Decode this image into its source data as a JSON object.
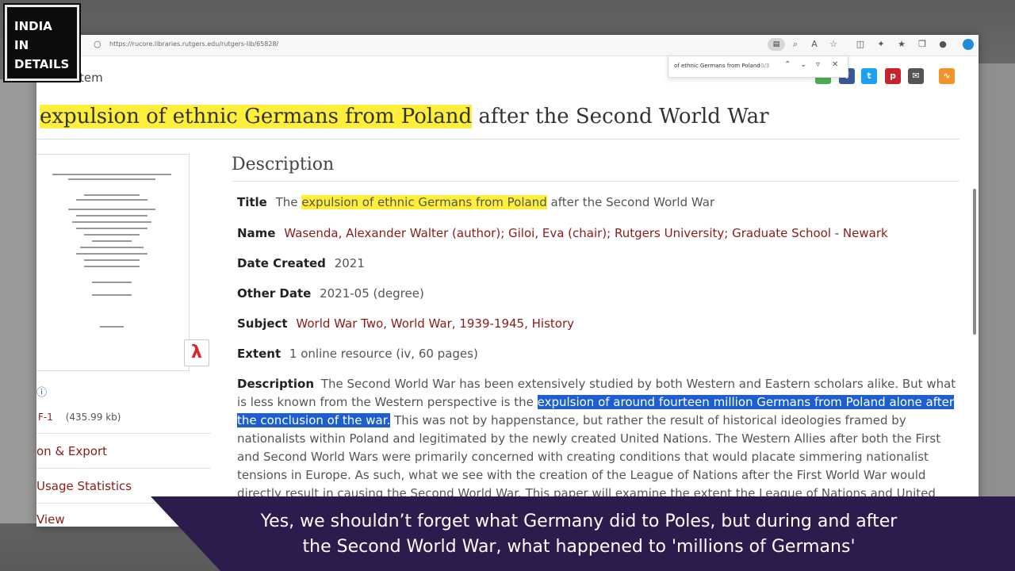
{
  "logo": {
    "line1": "INDIA",
    "line2": "IN",
    "line3": "DETAILS"
  },
  "browser": {
    "url": "https://rucore.libraries.rutgers.edu/rutgers-lib/65828/",
    "find": {
      "query": "of ethnic Germans from Poland",
      "count": "0/3"
    }
  },
  "breadcrumb": "tem",
  "page": {
    "title_hl": "expulsion of ethnic Germans from Poland",
    "title_rest": "after the Second World War"
  },
  "sidebar": {
    "file_label": "F-1",
    "file_size": "(435.99 kb)",
    "links": [
      "on & Export",
      "Usage Statistics",
      "View"
    ]
  },
  "description": {
    "heading": "Description",
    "title_label": "Title",
    "title_pre": "The",
    "title_hl": "expulsion of ethnic Germans from Poland",
    "title_post": "after the Second World War",
    "name_label": "Name",
    "name_value": "Wasenda, Alexander Walter (author); Giloi, Eva (chair); Rutgers University; Graduate School - Newark",
    "date_label": "Date Created",
    "date_value": "2021",
    "other_label": "Other Date",
    "other_value": "2021-05 (degree)",
    "subject_label": "Subject",
    "subject_value": "World War Two, World War, 1939-1945, History",
    "extent_label": "Extent",
    "extent_value": "1 online resource (iv, 60 pages)",
    "desc_label": "Description",
    "desc_pre": "The Second World War has been extensively studied by both Western and Eastern scholars alike. But what is less known from the Western perspective is the",
    "desc_sel": "expulsion of around fourteen million Germans from Poland alone after the conclusion of the war.",
    "desc_post": "This was not by happenstance, but rather the result of historical ideologies framed by nationalists within Poland and legitimated by the newly created United Nations. The Western Allies after both the First and Second World Wars were primarily concerned with creating conditions that would placate simmering nationalist tensions in Europe. As such, what we see with the creation of the League of Nations after the First World War would directly result in causing the Second World War. This paper will examine the extent the League of Nations and United"
  },
  "caption": {
    "line1": "Yes, we shouldn’t forget what Germany did to Poles, but during and after",
    "line2": "the Second World War, what happened to 'millions of Germans'"
  },
  "colors": {
    "highlight": "#ffef3a",
    "selection": "#1d5fd1",
    "link": "#8b1a1a",
    "caption_bg": "#2e1b4e"
  }
}
